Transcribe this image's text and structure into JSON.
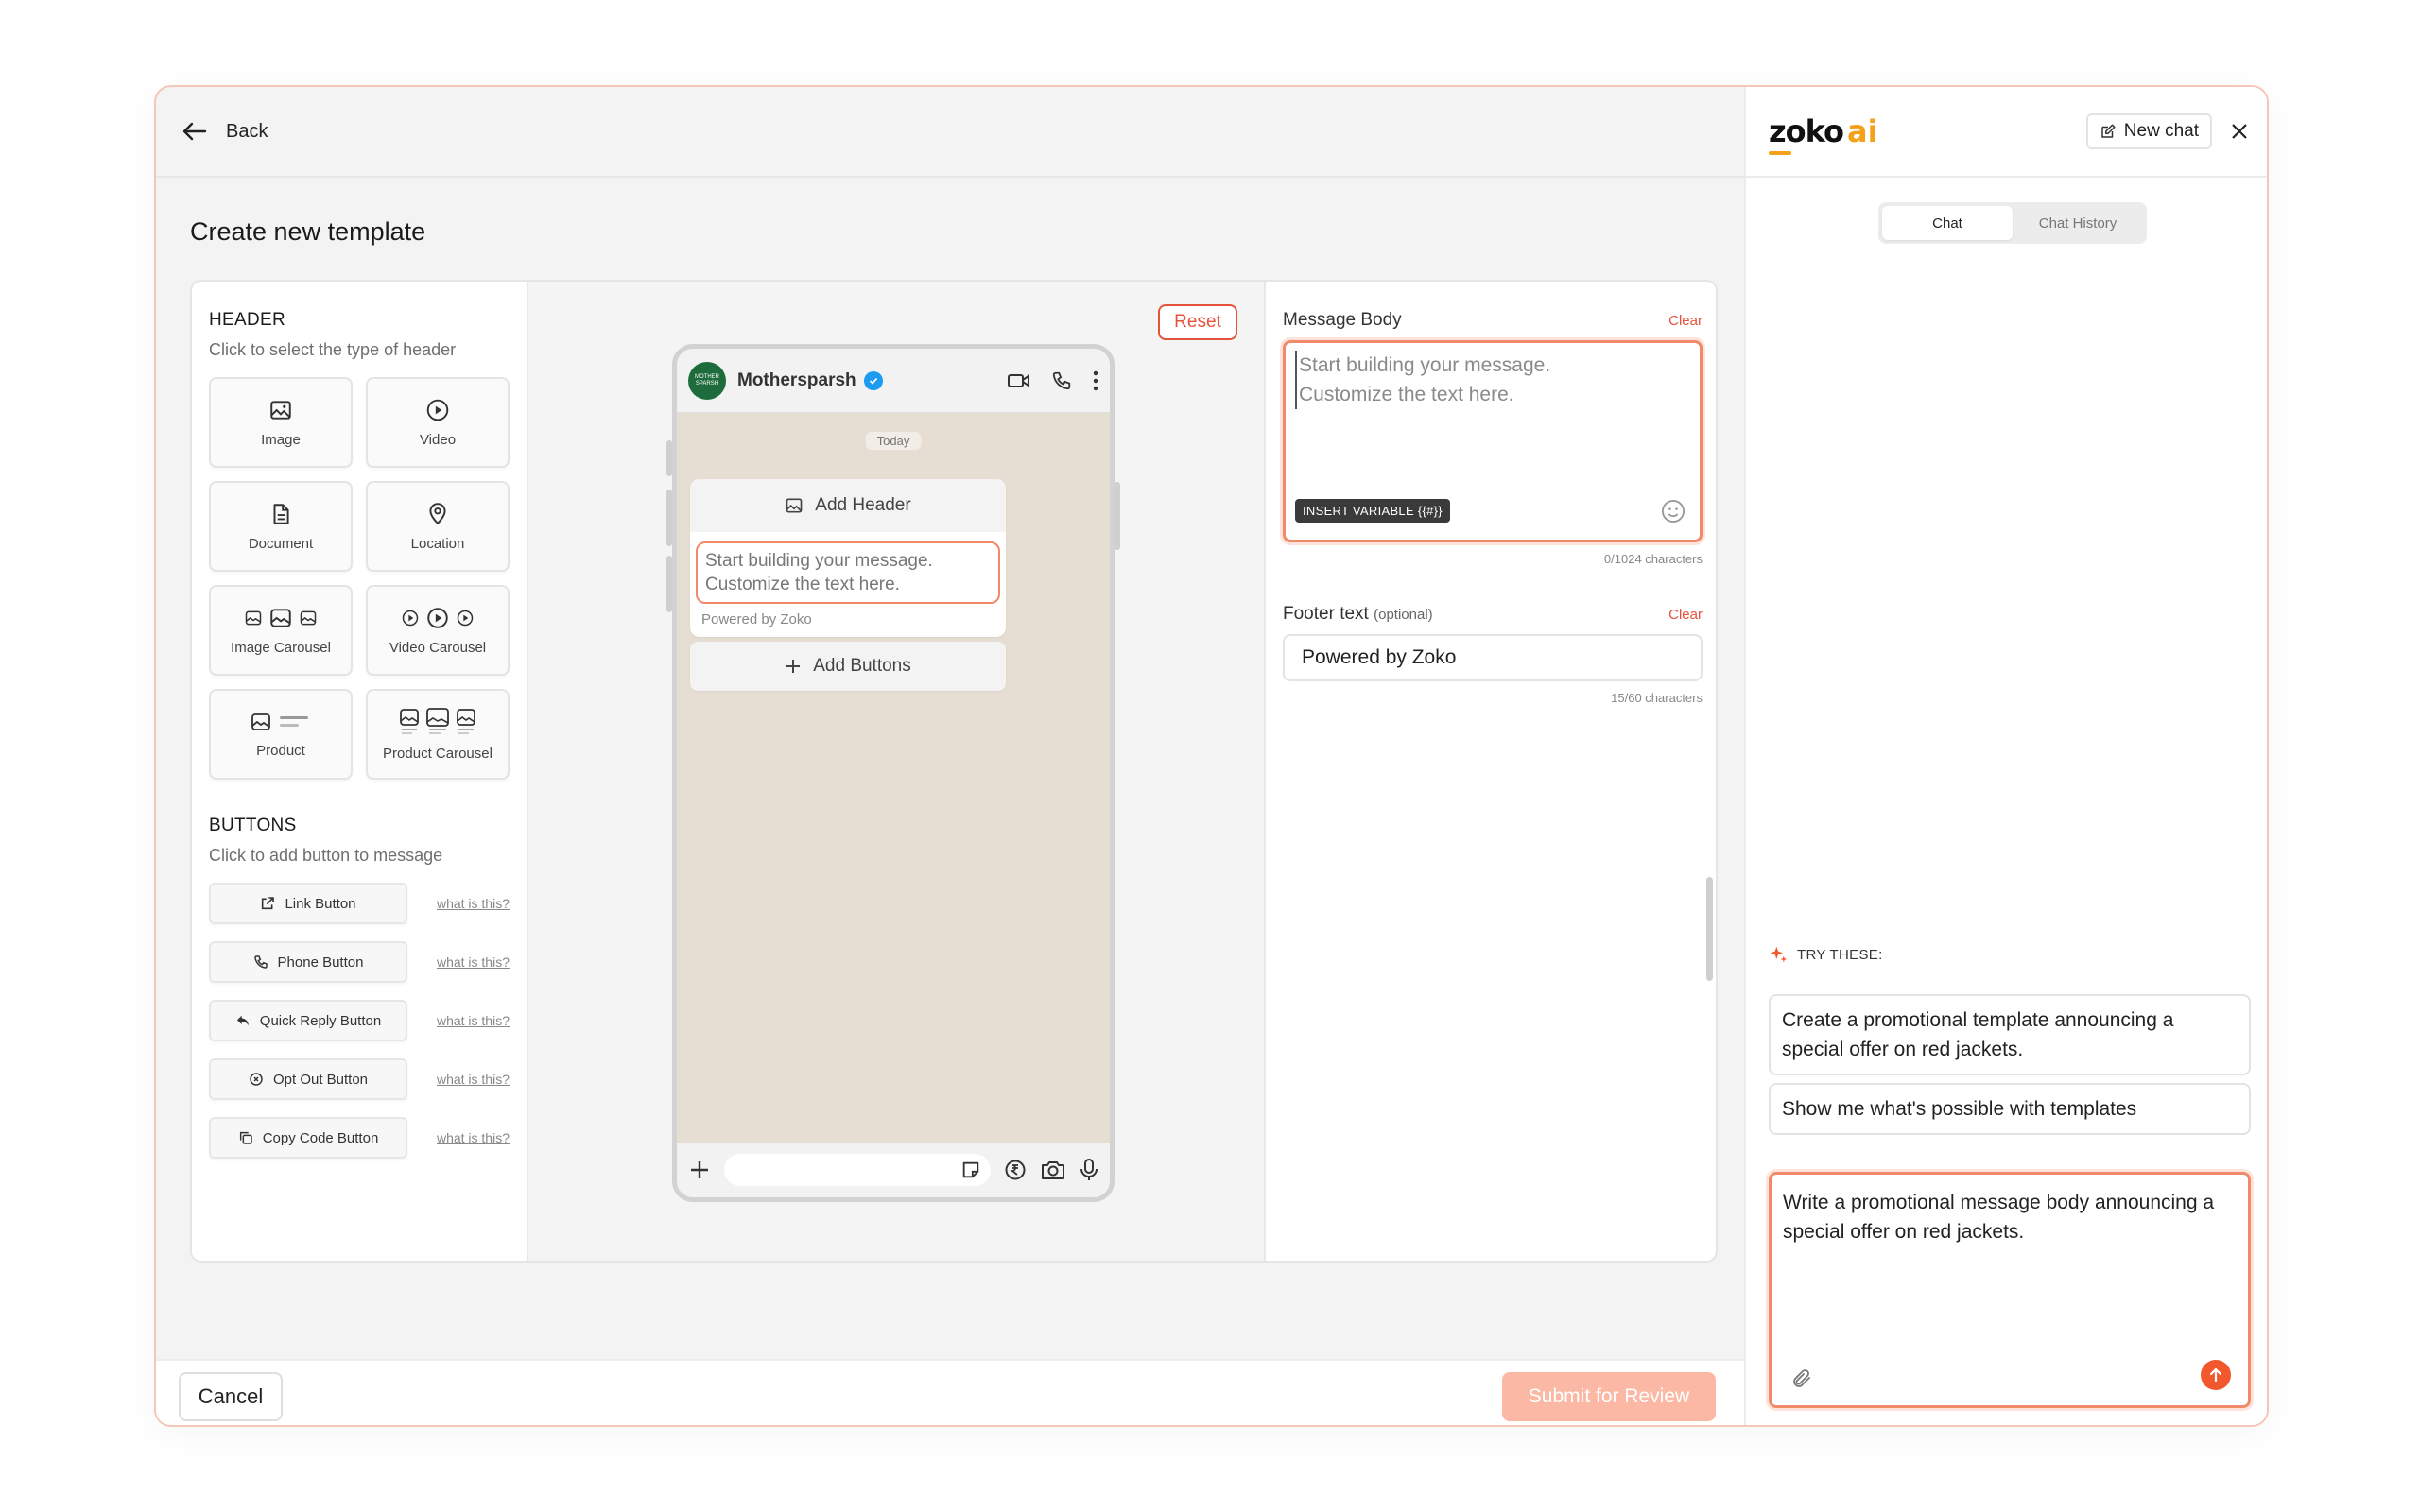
{
  "top": {
    "back_label": "Back"
  },
  "page_title": "Create new template",
  "header_section": {
    "title": "HEADER",
    "subtitle": "Click to select the type of header",
    "options": [
      {
        "label": "Image",
        "icon": "image-icon"
      },
      {
        "label": "Video",
        "icon": "video-icon"
      },
      {
        "label": "Document",
        "icon": "document-icon"
      },
      {
        "label": "Location",
        "icon": "location-pin-icon"
      },
      {
        "label": "Image Carousel",
        "icon": "image-carousel-icon"
      },
      {
        "label": "Video Carousel",
        "icon": "video-carousel-icon"
      },
      {
        "label": "Product",
        "icon": "product-icon"
      },
      {
        "label": "Product Carousel",
        "icon": "product-carousel-icon"
      }
    ]
  },
  "buttons_section": {
    "title": "BUTTONS",
    "subtitle": "Click to add button to message",
    "help_text": "what is this?",
    "items": [
      {
        "label": "Link Button",
        "icon": "external-link-icon"
      },
      {
        "label": "Phone Button",
        "icon": "phone-icon"
      },
      {
        "label": "Quick Reply Button",
        "icon": "reply-icon"
      },
      {
        "label": "Opt Out Button",
        "icon": "circle-x-icon"
      },
      {
        "label": "Copy Code Button",
        "icon": "copy-icon"
      }
    ]
  },
  "preview": {
    "reset_label": "Reset",
    "contact_name": "Mothersparsh",
    "avatar_text": "MOTHER SPARSH",
    "date_chip": "Today",
    "add_header_label": "Add Header",
    "body_placeholder": "Start building your message. Customize the text here.",
    "footer_text": "Powered by Zoko",
    "add_buttons_label": "Add Buttons"
  },
  "editor": {
    "body_label": "Message Body",
    "clear_label": "Clear",
    "body_placeholder": "Start building your message.\nCustomize the text here.",
    "insert_variable_label": "INSERT VARIABLE {{#}}",
    "body_char_count": "0/1024 characters",
    "footer_label": "Footer text",
    "footer_optional": "(optional)",
    "footer_value": "Powered by Zoko",
    "footer_char_count": "15/60 characters"
  },
  "actions": {
    "cancel_label": "Cancel",
    "submit_label": "Submit for Review"
  },
  "assistant": {
    "logo_text": "zoko",
    "logo_ai": "ai",
    "new_chat_label": "New chat",
    "tabs": [
      {
        "label": "Chat",
        "active": true
      },
      {
        "label": "Chat History",
        "active": false
      }
    ],
    "try_label": "TRY THESE:",
    "suggestions": [
      "Create a promotional template announcing a special offer on red jackets.",
      "Show me what's possible with templates"
    ],
    "input_value": "Write a promotional message body announcing a special offer on red jackets."
  },
  "colors": {
    "accent": "#f2582d",
    "border_accent": "#f08a6b",
    "clear_red": "#e5533d",
    "logo_yellow": "#f4a21b",
    "submit_disabled": "#fbb8a5"
  }
}
